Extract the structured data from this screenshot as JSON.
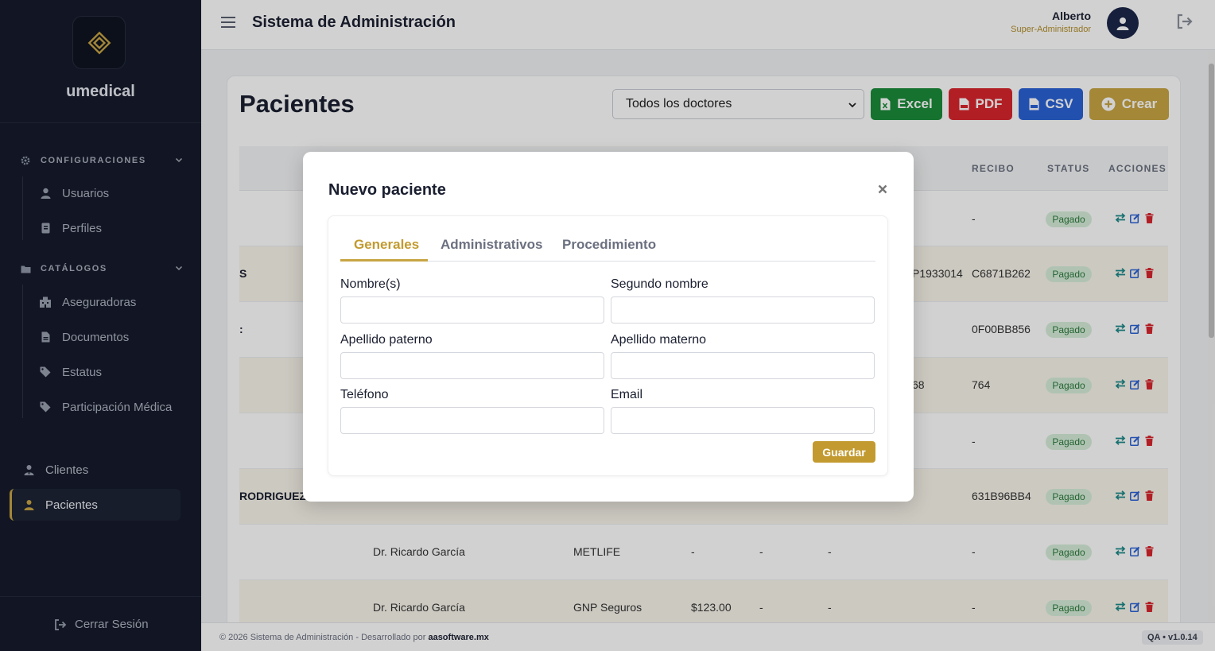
{
  "app": {
    "brand": "umedical",
    "system_title": "Sistema de Administración",
    "user_name": "Alberto",
    "user_role": "Super-Administrador"
  },
  "sidebar": {
    "config_section": "CONFIGURACIONES",
    "config_items": [
      {
        "label": "Usuarios",
        "icon": "user-icon"
      },
      {
        "label": "Perfiles",
        "icon": "id-card-icon"
      }
    ],
    "catalog_section": "CATÁLOGOS",
    "catalog_items": [
      {
        "label": "Aseguradoras",
        "icon": "building-icon"
      },
      {
        "label": "Documentos",
        "icon": "document-icon"
      },
      {
        "label": "Estatus",
        "icon": "tag-icon"
      },
      {
        "label": "Participación Médica",
        "icon": "tag-icon"
      }
    ],
    "main_items": [
      {
        "label": "Clientes",
        "icon": "user-tie-icon"
      },
      {
        "label": "Pacientes",
        "icon": "user-injured-icon",
        "active": true
      }
    ],
    "logout": "Cerrar Sesión"
  },
  "page": {
    "title": "Pacientes",
    "doctor_filter": "Todos los doctores",
    "buttons": {
      "excel": "Excel",
      "pdf": "PDF",
      "csv": "CSV",
      "crear": "Crear"
    },
    "table_headers": [
      "RECIBO",
      "STATUS",
      "ACCIONES"
    ],
    "rows": [
      {
        "name": "",
        "doctor": "",
        "insurer": "",
        "amount": "",
        "c1": "",
        "c2": "",
        "policy": "",
        "receipt": "-",
        "status": "Pagado"
      },
      {
        "name": "S",
        "doctor": "",
        "insurer": "",
        "amount": "",
        "c1": "",
        "c2": "",
        "policy": "P1933014",
        "receipt": "C6871B262",
        "status": "Pagado"
      },
      {
        "name": ":",
        "doctor": "",
        "insurer": "",
        "amount": "",
        "c1": "",
        "c2": "",
        "policy": "",
        "receipt": "0F00BB856",
        "status": "Pagado"
      },
      {
        "name": "",
        "doctor": "",
        "insurer": "",
        "amount": "",
        "c1": "",
        "c2": "",
        "policy": "68",
        "receipt": "764",
        "status": "Pagado"
      },
      {
        "name": "",
        "doctor": "",
        "insurer": "",
        "amount": "",
        "c1": "",
        "c2": "",
        "policy": "",
        "receipt": "-",
        "status": "Pagado"
      },
      {
        "name": "RODRIGUEZ",
        "doctor": "",
        "insurer": "",
        "amount": "",
        "c1": "",
        "c2": "",
        "policy": "",
        "receipt": "631B96BB4",
        "status": "Pagado"
      },
      {
        "name": "",
        "doctor": "Dr. Ricardo García",
        "insurer": "METLIFE",
        "amount": "-",
        "c1": "-",
        "c2": "-",
        "policy": "",
        "receipt": "-",
        "status": "Pagado"
      },
      {
        "name": "",
        "doctor": "Dr. Ricardo García",
        "insurer": "GNP Seguros",
        "amount": "$123.00",
        "c1": "-",
        "c2": "-",
        "policy": "",
        "receipt": "-",
        "status": "Pagado"
      }
    ]
  },
  "modal": {
    "title": "Nuevo paciente",
    "tabs": [
      "Generales",
      "Administrativos",
      "Procedimiento"
    ],
    "fields": {
      "nombre": {
        "label": "Nombre(s)",
        "value": ""
      },
      "segundo_nombre": {
        "label": "Segundo nombre",
        "value": ""
      },
      "apellido_paterno": {
        "label": "Apellido paterno",
        "value": ""
      },
      "apellido_materno": {
        "label": "Apellido materno",
        "value": ""
      },
      "telefono": {
        "label": "Teléfono",
        "value": ""
      },
      "email": {
        "label": "Email",
        "value": ""
      }
    },
    "save": "Guardar"
  },
  "footer": {
    "prefix": "© 2026 Sistema de Administración - Desarrollado por ",
    "company": "aasoftware.mx",
    "version": "QA • v1.0.14"
  },
  "colors": {
    "sidebar_bg": "#161c2c",
    "accent_gold": "#c8a544",
    "excel_green": "#1b8c3a",
    "pdf_red": "#d8262e",
    "csv_blue": "#2a62d6",
    "status_paid": "#d7eedb"
  }
}
